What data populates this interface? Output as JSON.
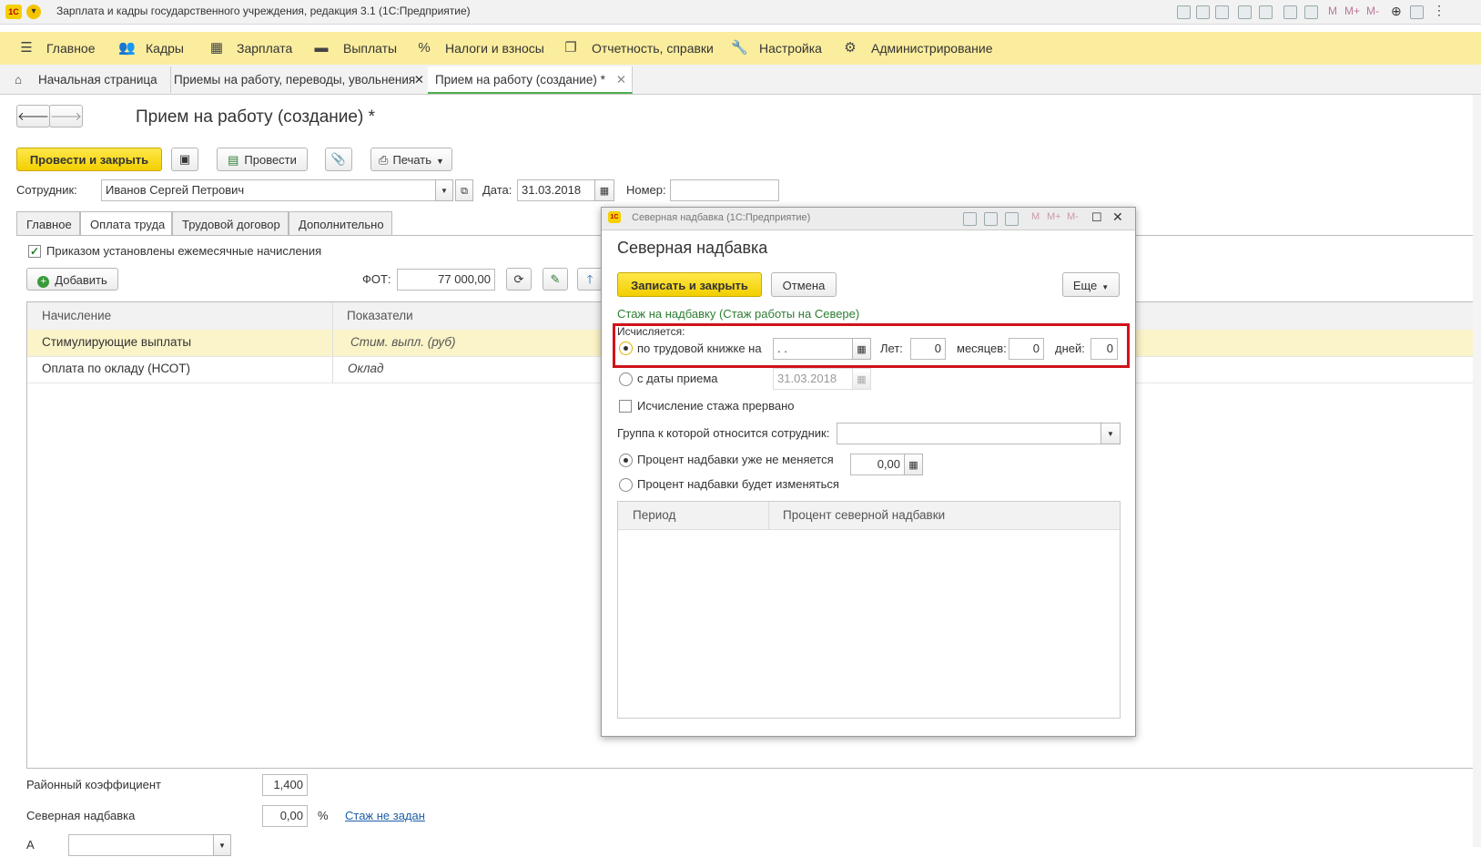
{
  "app": {
    "title": "Зарплата и кадры государственного учреждения, редакция 3.1  (1С:Предприятие)",
    "logo_text": "1С"
  },
  "menu": [
    {
      "label": "Главное",
      "icon": "hamburger-icon"
    },
    {
      "label": "Кадры",
      "icon": "people-icon"
    },
    {
      "label": "Зарплата",
      "icon": "calculator-icon"
    },
    {
      "label": "Выплаты",
      "icon": "wallet-icon"
    },
    {
      "label": "Налоги и взносы",
      "icon": "percent-icon"
    },
    {
      "label": "Отчетность, справки",
      "icon": "report-icon"
    },
    {
      "label": "Настройка",
      "icon": "wrench-icon"
    },
    {
      "label": "Администрирование",
      "icon": "gear-icon"
    }
  ],
  "window_tabs": [
    {
      "label": "Начальная страница",
      "icon": "home-icon"
    },
    {
      "label": "Приемы на работу, переводы, увольнения"
    },
    {
      "label": "Прием на работу (создание) *",
      "active": true
    }
  ],
  "form": {
    "title": "Прием на работу (создание) *",
    "toolbar": {
      "post_close": "Провести и закрыть",
      "post": "Провести",
      "print": "Печать"
    },
    "employee_label": "Сотрудник:",
    "employee_value": "Иванов Сергей Петрович",
    "date_label": "Дата:",
    "date_value": "31.03.2018",
    "number_label": "Номер:",
    "number_value": "",
    "tabs": [
      "Главное",
      "Оплата труда",
      "Трудовой договор",
      "Дополнительно"
    ],
    "active_tab": "Оплата труда",
    "monthly_check_label": "Приказом установлены ежемесячные начисления",
    "add_button": "Добавить",
    "fot_label": "ФОТ:",
    "fot_value": "77 000,00",
    "grid": {
      "headers": [
        "Начисление",
        "Показатели"
      ],
      "rows": [
        {
          "name": "Стимулирующие выплаты",
          "indicator": "Стим. выпл. (руб)"
        },
        {
          "name": "Оплата по окладу (НСОТ)",
          "indicator": "Оклад"
        }
      ]
    },
    "district_coef_label": "Районный коэффициент",
    "district_coef_value": "1,400",
    "north_label": "Северная надбавка",
    "north_value": "0,00",
    "north_unit": "%",
    "north_link": "Стаж не задан",
    "bottom_label": "А"
  },
  "dialog": {
    "window_title": "Северная надбавка  (1С:Предприятие)",
    "heading": "Северная надбавка",
    "save_close": "Записать и закрыть",
    "cancel": "Отмена",
    "more": "Еще",
    "section_title": "Стаж на надбавку (Стаж работы на Севере)",
    "calc_label": "Исчисляется:",
    "by_book_label": "по трудовой книжке на",
    "by_book_date": " .  .",
    "years_label": "Лет:",
    "years_value": "0",
    "months_label": "месяцев:",
    "months_value": "0",
    "days_label": "дней:",
    "days_value": "0",
    "from_hire_label": "с даты приема",
    "from_hire_date": "31.03.2018",
    "interrupted_label": "Исчисление стажа прервано",
    "group_label": "Группа к которой относится сотрудник:",
    "group_value": "",
    "fixed_percent_label": "Процент надбавки уже не меняется",
    "fixed_percent_value": "0,00",
    "changing_percent_label": "Процент надбавки будет изменяться",
    "table_headers": [
      "Период",
      "Процент северной надбавки"
    ]
  },
  "colors": {
    "menu_bg": "#fbed9e",
    "primary_button": "#f2cf00",
    "highlight": "#d0121b",
    "selected_row": "#fbf4c9"
  }
}
